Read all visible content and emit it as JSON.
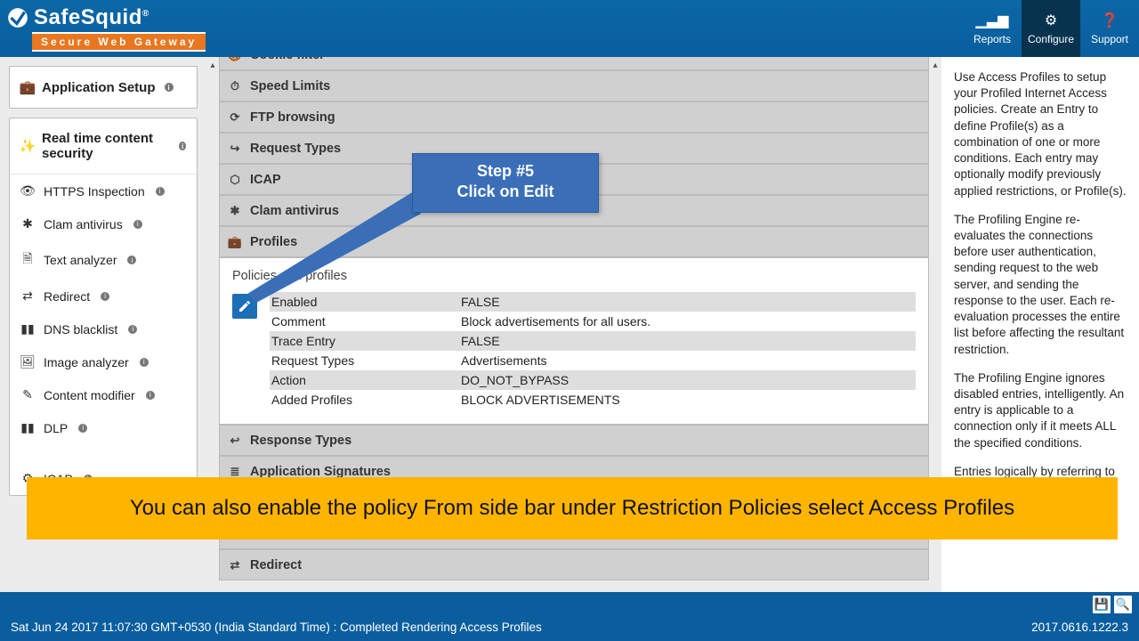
{
  "brand": {
    "name": "SafeSquid",
    "reg": "®",
    "subtitle": "Secure Web Gateway"
  },
  "nav": {
    "reports": "Reports",
    "configure": "Configure",
    "support": "Support"
  },
  "sidebar": {
    "card1_title": "Application Setup",
    "card2_title": "Real time content security",
    "items": [
      {
        "icon": "eye-icon",
        "glyph": "👁",
        "label": "HTTPS Inspection"
      },
      {
        "icon": "asterisk-icon",
        "glyph": "✱",
        "label": "Clam antivirus"
      },
      {
        "icon": "file-text-icon",
        "glyph": "🗎",
        "label": "Text analyzer"
      },
      {
        "icon": "shuffle-icon",
        "glyph": "⇄",
        "label": "Redirect"
      },
      {
        "icon": "barcode-icon",
        "glyph": "▮▮",
        "label": "DNS blacklist"
      },
      {
        "icon": "picture-icon",
        "glyph": "🖼",
        "label": "Image analyzer"
      },
      {
        "icon": "edit-icon",
        "glyph": "✎",
        "label": "Content modifier"
      },
      {
        "icon": "barcode-icon",
        "glyph": "▮▮",
        "label": "DLP"
      },
      {
        "icon": "blank-icon",
        "glyph": "",
        "label": ""
      },
      {
        "icon": "cog-icon",
        "glyph": "⚙",
        "label": "ICAP"
      }
    ]
  },
  "sections": [
    {
      "icon": "cookie-icon",
      "glyph": "🍪",
      "label": "Cookie filter"
    },
    {
      "icon": "gauge-icon",
      "glyph": "⏱",
      "label": "Speed Limits"
    },
    {
      "icon": "refresh-icon",
      "glyph": "⟳",
      "label": "FTP browsing"
    },
    {
      "icon": "forward-icon",
      "glyph": "↪",
      "label": "Request Types"
    },
    {
      "icon": "hexagon-icon",
      "glyph": "⬡",
      "label": "ICAP"
    },
    {
      "icon": "asterisk-icon",
      "glyph": "✱",
      "label": "Clam antivirus"
    },
    {
      "icon": "briefcase-icon",
      "glyph": "💼",
      "label": "Profiles"
    }
  ],
  "profiles": {
    "subtitle": "Policies and profiles",
    "rows": [
      {
        "k": "Enabled",
        "v": "FALSE"
      },
      {
        "k": "Comment",
        "v": "Block advertisements for all users."
      },
      {
        "k": "Trace Entry",
        "v": "FALSE"
      },
      {
        "k": "Request Types",
        "v": "Advertisements"
      },
      {
        "k": "Action",
        "v": "DO_NOT_BYPASS"
      },
      {
        "k": "Added Profiles",
        "v": "BLOCK ADVERTISEMENTS"
      }
    ]
  },
  "sections_after": [
    {
      "icon": "reply-icon",
      "glyph": "↩",
      "label": "Response Types"
    },
    {
      "icon": "list-icon",
      "glyph": "≣",
      "label": "Application Signatures"
    },
    {
      "icon": "blank-icon",
      "glyph": "",
      "label": ""
    },
    {
      "icon": "blank-icon",
      "glyph": "",
      "label": ""
    },
    {
      "icon": "shuffle-icon",
      "glyph": "⇄",
      "label": "Redirect"
    }
  ],
  "help": {
    "p1": "Use Access Profiles to setup your Profiled Internet Access policies. Create an Entry to define Profile(s) as a combination of one or more conditions. Each entry may optionally modify previously applied restrictions, or Profile(s).",
    "p2": "The Profiling Engine re-evaluates the connections before user authentication, sending request to the web server, and sending the response to the user. Each re-evaluation processes the entire list before affecting the resultant restriction.",
    "p3": "The Profiling Engine ignores disabled entries, intelligently. An entry is applicable to a connection only if it meets ALL the specified conditions.",
    "p4": "Entries logically by referring to Profiles, applied in a previous"
  },
  "callout": {
    "line1": "Step #5",
    "line2": "Click on Edit"
  },
  "banner": "You can also enable the policy From side bar under Restriction Policies select Access Profiles",
  "footer": {
    "status": "Sat Jun 24 2017 11:07:30 GMT+0530 (India Standard Time) : Completed Rendering Access Profiles",
    "version": "2017.0616.1222.3"
  }
}
